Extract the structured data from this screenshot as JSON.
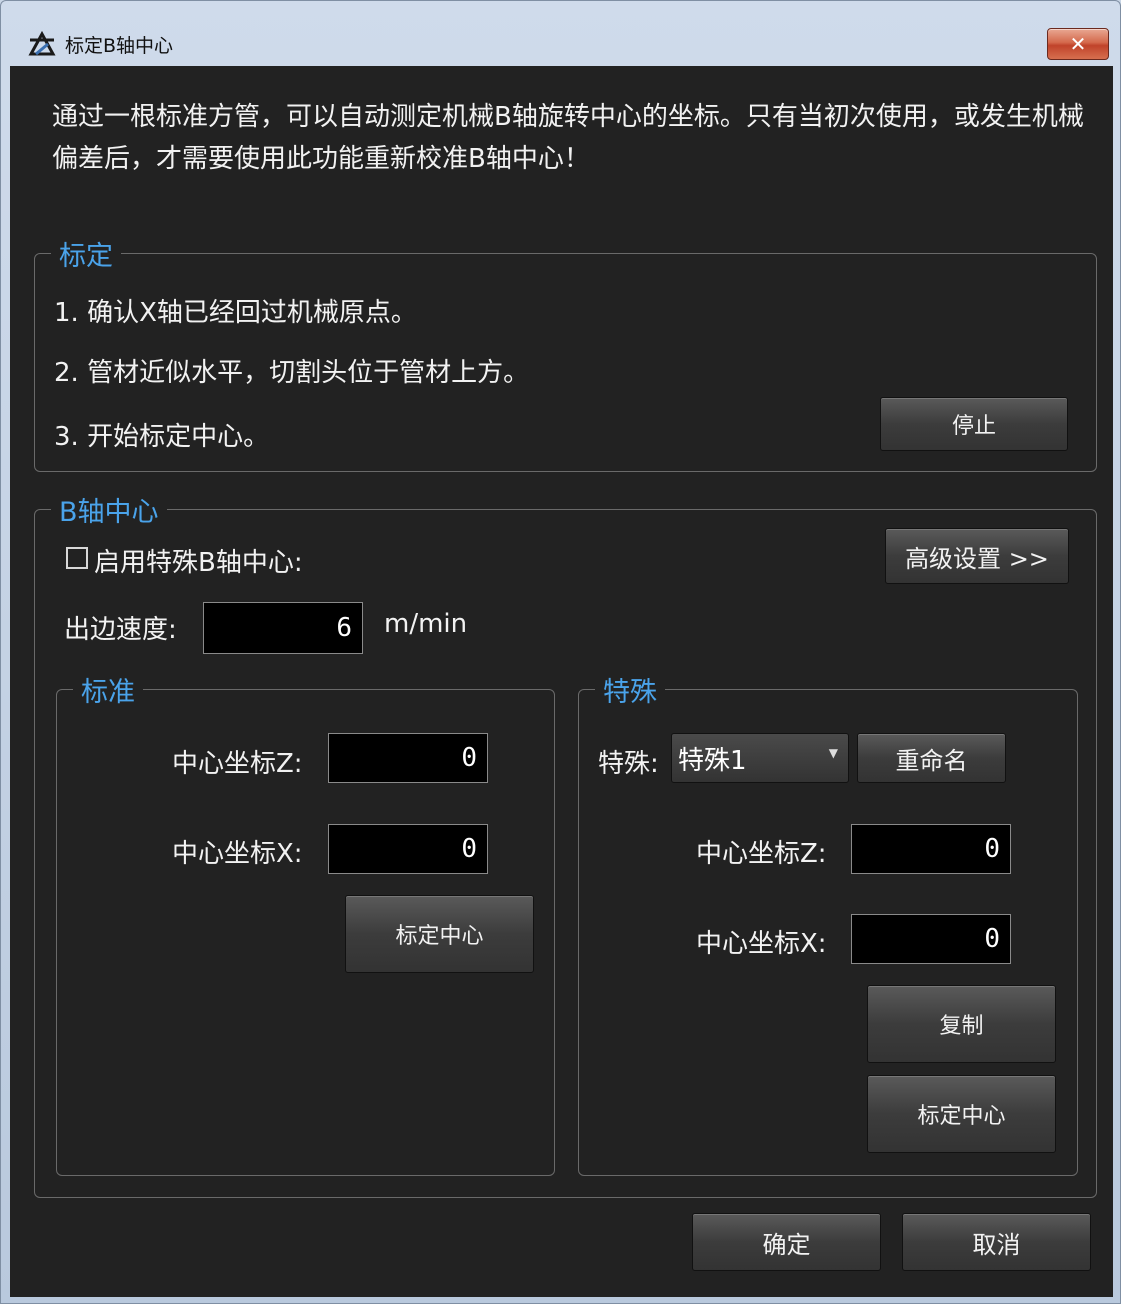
{
  "window": {
    "title": "标定B轴中心",
    "close_label": "✕"
  },
  "intro": "通过一根标准方管，可以自动测定机械B轴旋转中心的坐标。只有当初次使用，或发生机械偏差后，才需要使用此功能重新校准B轴中心！",
  "calibrate": {
    "legend": "标定",
    "steps": [
      "1. 确认X轴已经回过机械原点。",
      "2. 管材近似水平，切割头位于管材上方。",
      "3. 开始标定中心。"
    ],
    "stop_label": "停止"
  },
  "bcenter": {
    "legend": "B轴中心",
    "enable_special_label": "启用特殊B轴中心:",
    "enable_special_checked": false,
    "advanced_label": "高级设置 >>",
    "speed_label": "出边速度:",
    "speed_value": "6",
    "speed_unit": "m/min",
    "standard": {
      "legend": "标准",
      "z_label": "中心坐标Z:",
      "z_value": "0",
      "x_label": "中心坐标X:",
      "x_value": "0",
      "calibrate_label": "标定中心"
    },
    "special": {
      "legend": "特殊",
      "select_label": "特殊:",
      "select_value": "特殊1",
      "rename_label": "重命名",
      "z_label": "中心坐标Z:",
      "z_value": "0",
      "x_label": "中心坐标X:",
      "x_value": "0",
      "copy_label": "复制",
      "calibrate_label": "标定中心"
    }
  },
  "footer": {
    "ok_label": "确定",
    "cancel_label": "取消"
  }
}
